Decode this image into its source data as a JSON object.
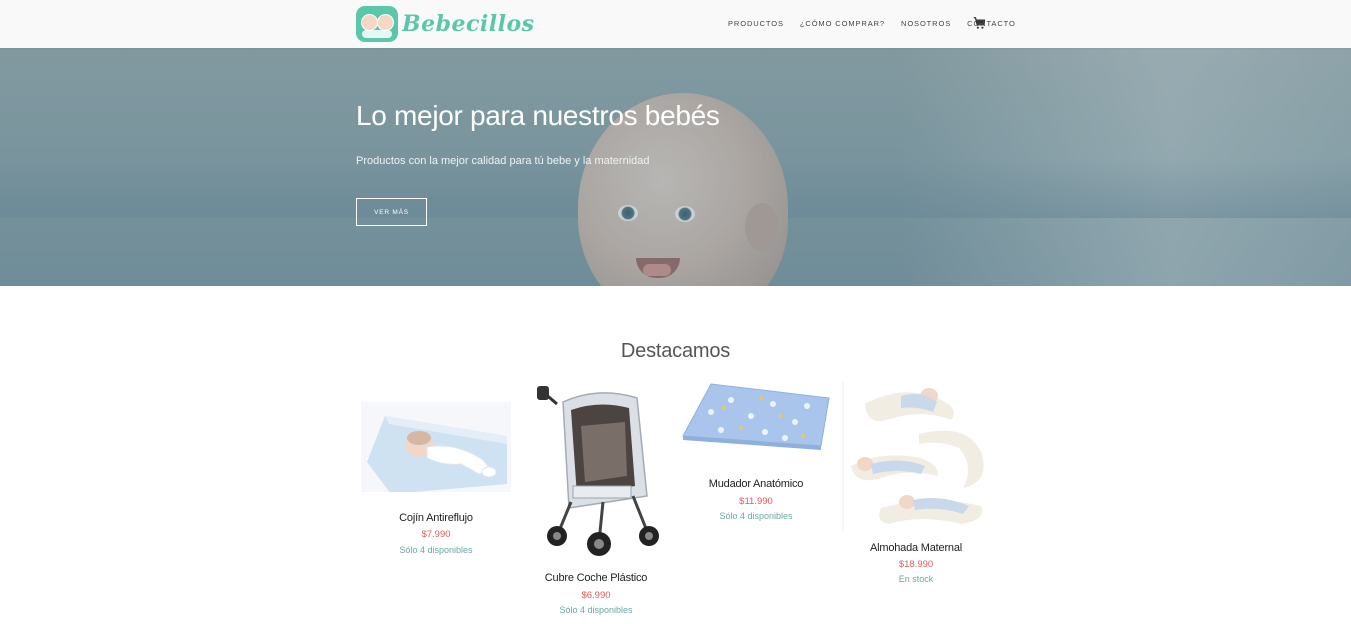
{
  "brand": {
    "name": "Bebecillos",
    "logo_color": "#5ac7aa"
  },
  "nav": {
    "items": [
      {
        "label": "PRODUCTOS"
      },
      {
        "label": "¿CÓMO COMPRAR?"
      },
      {
        "label": "NOSOTROS"
      },
      {
        "label": "CONTACTO"
      }
    ],
    "cart_icon": "shopping-cart-icon"
  },
  "hero": {
    "title": "Lo mejor para nuestros bebés",
    "subtitle": "Productos con la mejor calidad para tú bebe y la maternidad",
    "button_label": "VER MÁS"
  },
  "featured": {
    "title": "Destacamos",
    "products": [
      {
        "name": "Cojín Antireflujo",
        "price": "$7.990",
        "stock": "Sólo 4 disponibles"
      },
      {
        "name": "Cubre Coche Plástico",
        "price": "$6.990",
        "stock": "Sólo 4 disponibles"
      },
      {
        "name": "Mudador Anatómico",
        "price": "$11.990",
        "stock": "Sólo 4 disponibles"
      },
      {
        "name": "Almohada Maternal",
        "price": "$18.990",
        "stock": "En stock"
      }
    ]
  },
  "colors": {
    "price": "#e15a5a",
    "stock": "#6aa8a0",
    "accent": "#5ac7aa"
  }
}
